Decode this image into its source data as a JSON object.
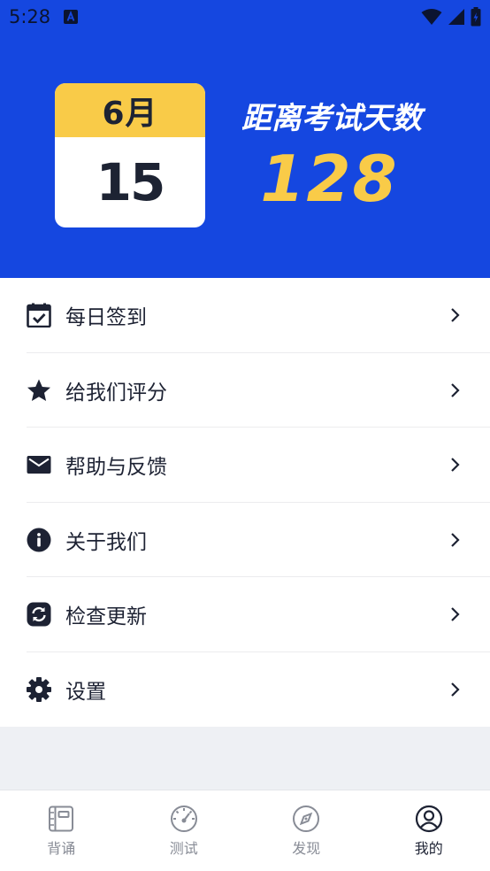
{
  "status_bar": {
    "time": "5:28"
  },
  "header": {
    "calendar": {
      "month": "6月",
      "day": "15"
    },
    "countdown_title": "距离考试天数",
    "countdown_value": "128"
  },
  "menu": {
    "items": [
      {
        "label": "每日签到",
        "icon": "calendar-check-icon"
      },
      {
        "label": "给我们评分",
        "icon": "star-icon"
      },
      {
        "label": "帮助与反馈",
        "icon": "mail-icon"
      },
      {
        "label": "关于我们",
        "icon": "info-icon"
      },
      {
        "label": "检查更新",
        "icon": "refresh-icon"
      },
      {
        "label": "设置",
        "icon": "gear-icon"
      }
    ]
  },
  "bottom_nav": {
    "items": [
      {
        "label": "背诵",
        "icon": "notebook-icon"
      },
      {
        "label": "测试",
        "icon": "speedometer-icon"
      },
      {
        "label": "发现",
        "icon": "compass-icon"
      },
      {
        "label": "我的",
        "icon": "user-circle-icon"
      }
    ],
    "active_index": 3
  },
  "colors": {
    "header_bg": "#1547e0",
    "accent_yellow": "#f9cb48",
    "dark": "#1d2233",
    "nav_inactive": "#888c96"
  }
}
